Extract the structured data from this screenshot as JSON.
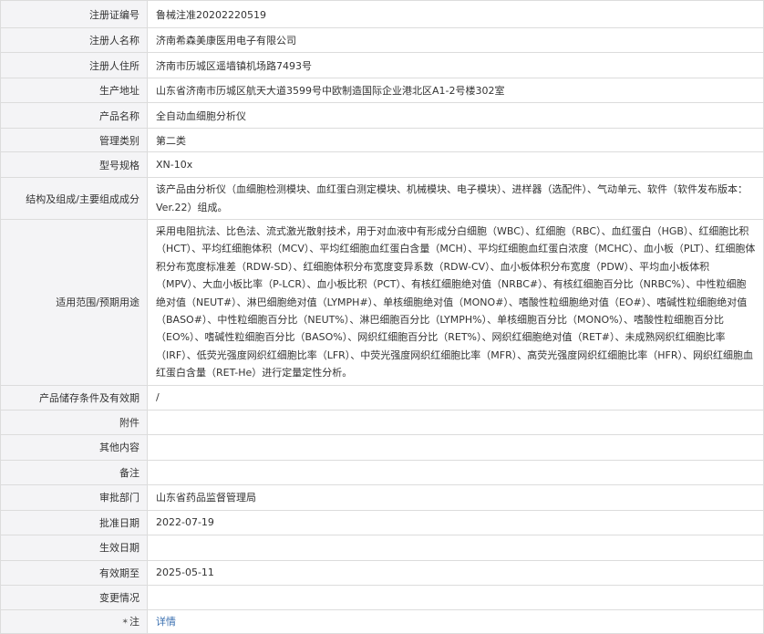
{
  "rows": [
    {
      "label": "注册证编号",
      "value": "鲁械注准20202220519"
    },
    {
      "label": "注册人名称",
      "value": "济南希森美康医用电子有限公司"
    },
    {
      "label": "注册人住所",
      "value": "济南市历城区遥墙镇机场路7493号"
    },
    {
      "label": "生产地址",
      "value": "山东省济南市历城区航天大道3599号中欧制造国际企业港北区A1-2号楼302室"
    },
    {
      "label": "产品名称",
      "value": "全自动血细胞分析仪"
    },
    {
      "label": "管理类别",
      "value": "第二类"
    },
    {
      "label": "型号规格",
      "value": "XN-10x"
    },
    {
      "label": "结构及组成/主要组成成分",
      "value": "该产品由分析仪（血细胞检测模块、血红蛋白测定模块、机械模块、电子模块）、进样器（选配件）、气动单元、软件（软件发布版本：Ver.22）组成。"
    },
    {
      "label": "适用范围/预期用途",
      "value": "采用电阻抗法、比色法、流式激光散射技术，用于对血液中有形成分白细胞（WBC）、红细胞（RBC）、血红蛋白（HGB）、红细胞比积（HCT）、平均红细胞体积（MCV）、平均红细胞血红蛋白含量（MCH）、平均红细胞血红蛋白浓度（MCHC）、血小板（PLT）、红细胞体积分布宽度标准差（RDW-SD）、红细胞体积分布宽度变异系数（RDW-CV）、血小板体积分布宽度（PDW）、平均血小板体积（MPV）、大血小板比率（P-LCR）、血小板比积（PCT）、有核红细胞绝对值（NRBC#）、有核红细胞百分比（NRBC%）、中性粒细胞绝对值（NEUT#）、淋巴细胞绝对值（LYMPH#）、单核细胞绝对值（MONO#）、嗜酸性粒细胞绝对值（EO#）、嗜碱性粒细胞绝对值（BASO#）、中性粒细胞百分比（NEUT%）、淋巴细胞百分比（LYMPH%）、单核细胞百分比（MONO%）、嗜酸性粒细胞百分比（EO%）、嗜碱性粒细胞百分比（BASO%）、网织红细胞百分比（RET%）、网织红细胞绝对值（RET#）、未成熟网织红细胞比率（IRF）、低荧光强度网织红细胞比率（LFR）、中荧光强度网织红细胞比率（MFR）、高荧光强度网织红细胞比率（HFR）、网织红细胞血红蛋白含量（RET-He）进行定量定性分析。"
    },
    {
      "label": "产品储存条件及有效期",
      "value": "/"
    },
    {
      "label": "附件",
      "value": ""
    },
    {
      "label": "其他内容",
      "value": ""
    },
    {
      "label": "备注",
      "value": ""
    },
    {
      "label": "审批部门",
      "value": "山东省药品监督管理局"
    },
    {
      "label": "批准日期",
      "value": "2022-07-19"
    },
    {
      "label": "生效日期",
      "value": ""
    },
    {
      "label": "有效期至",
      "value": "2025-05-11"
    },
    {
      "label": "变更情况",
      "value": ""
    }
  ],
  "note": {
    "icon": "star-icon",
    "label": "注",
    "link_text": "详情"
  }
}
